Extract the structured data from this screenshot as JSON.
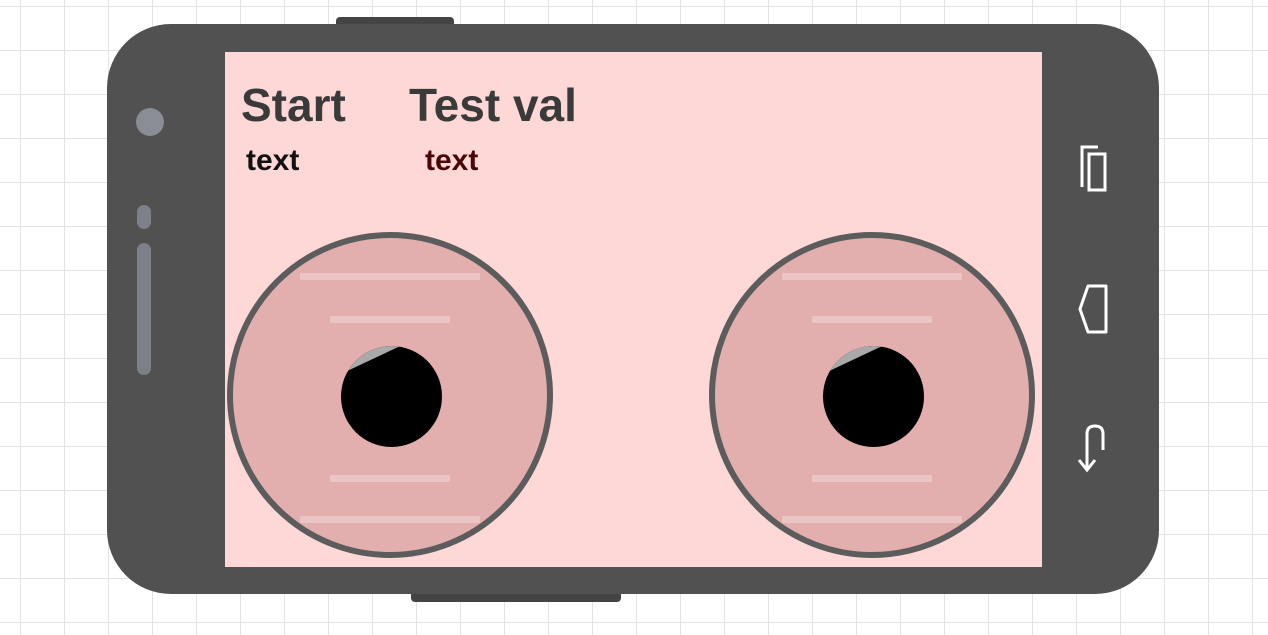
{
  "screen": {
    "labels": {
      "start_title": "Start",
      "start_text": "text",
      "test_title": "Test val",
      "test_text": "text"
    },
    "joysticks": [
      {
        "name": "left-joystick"
      },
      {
        "name": "right-joystick"
      }
    ]
  },
  "device": {
    "nav_icons": [
      "recent-apps-icon",
      "home-icon",
      "back-icon"
    ]
  },
  "colors": {
    "screen_background": "#fed7d7",
    "joystick_fill": "#e2aeae",
    "joystick_border": "#5c5c5c",
    "knob": "#000000",
    "device_body": "#515151"
  }
}
